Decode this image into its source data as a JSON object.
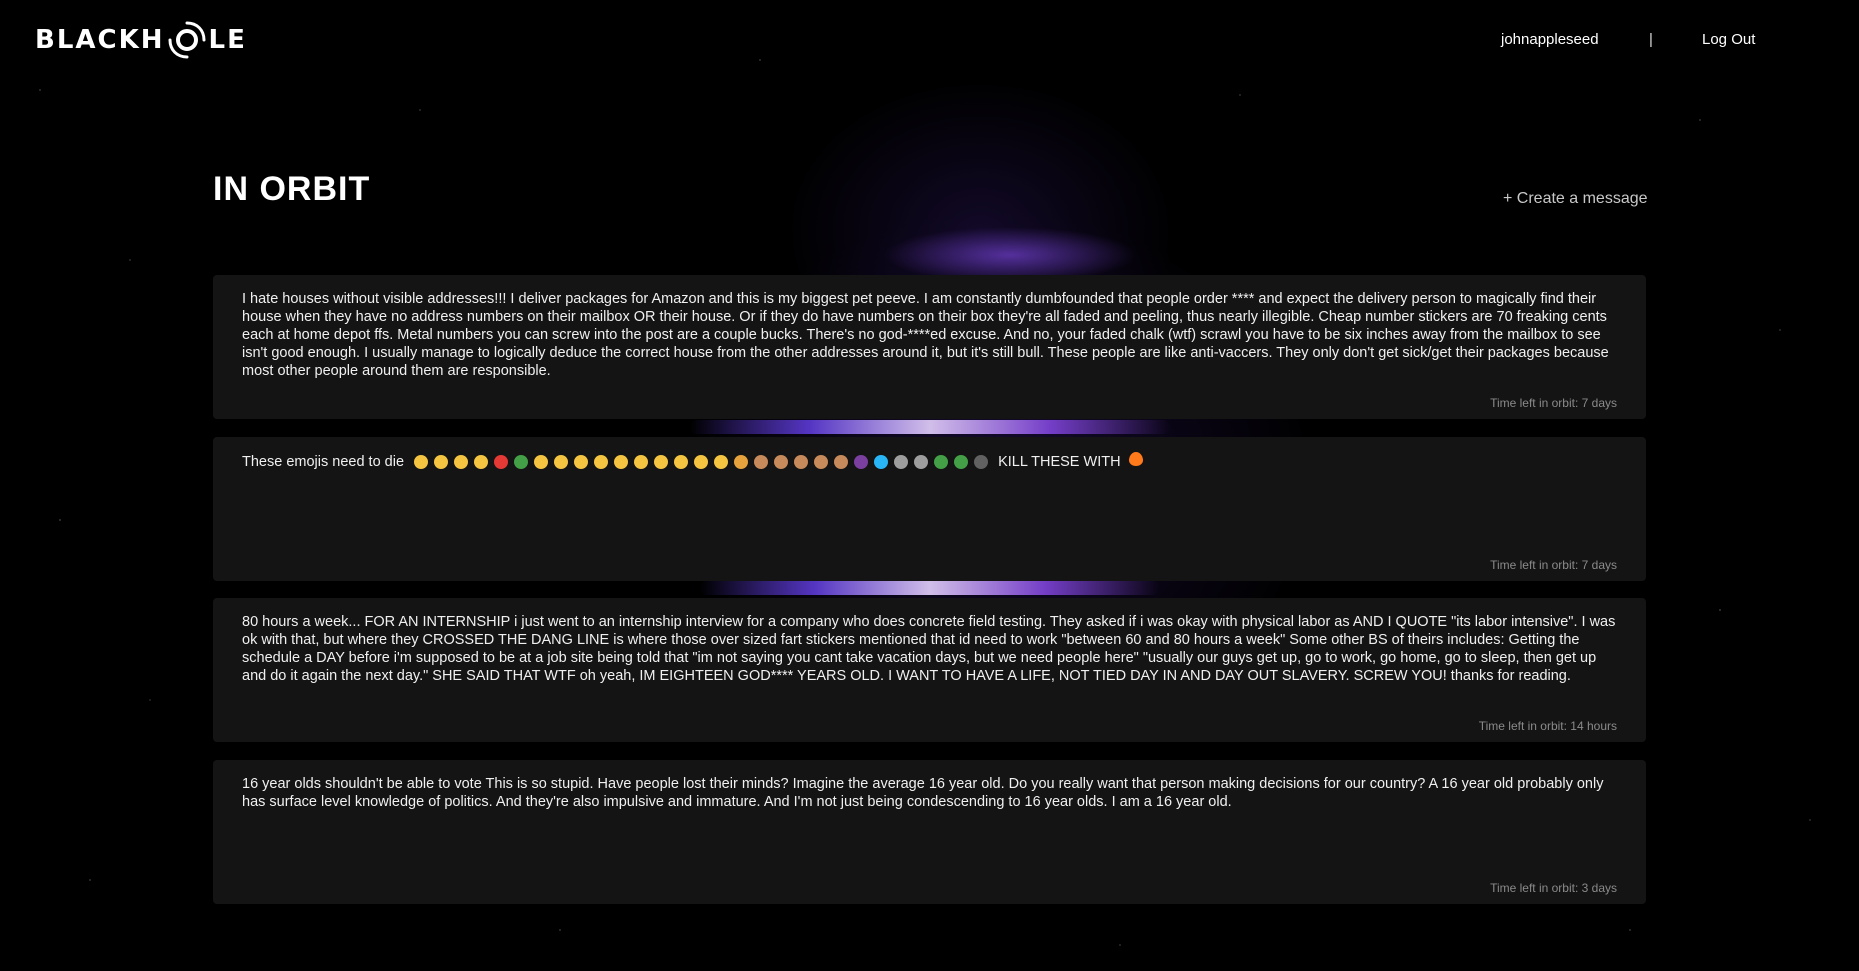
{
  "app": {
    "logo_text_left": "BLACKH",
    "logo_text_right": "LE",
    "username": "johnappleseed",
    "divider": "|",
    "logout_label": "Log Out"
  },
  "page": {
    "title": "IN ORBIT",
    "create_label": "+ Create a message"
  },
  "posts": [
    {
      "text": "I hate houses without visible addresses!!! I deliver packages for Amazon and this is my biggest pet peeve. I am constantly dumbfounded that people order **** and expect the delivery person to magically find their house when they have no address numbers on their mailbox OR their house. Or if they do have numbers on their box they're all faded and peeling, thus nearly illegible. Cheap number stickers are 70 freaking cents each at home depot ffs. Metal numbers you can screw into the post are a couple bucks. There's no god-****ed excuse. And no, your faded chalk (wtf) scrawl you have to be six inches away from the mailbox to see isn't good enough. I usually manage to logically deduce the correct house from the other addresses around it, but it's still bull. These people are like anti-vaccers. They only don't get sick/get their packages because most other people around them are responsible.",
      "time_left": "Time left in orbit: 7 days"
    },
    {
      "text_before": "These emojis need to die",
      "text_after": "KILL THESE WITH",
      "time_left": "Time left in orbit: 7 days"
    },
    {
      "text": "80 hours a week... FOR AN INTERNSHIP i just went to an internship interview for a company who does concrete field testing. They asked if i was okay with physical labor as AND I QUOTE \"its labor intensive\". I was ok with that, but where they CROSSED THE DANG LINE is where those over sized fart stickers mentioned that id need to work \"between 60 and 80 hours a week\" Some other BS of theirs includes: Getting the schedule a DAY before i'm supposed to be at a job site being told that \"im not saying you cant take vacation days, but we need people here\" \"usually our guys get up, go to work, go home, go to sleep, then get up and do it again the next day.\" SHE SAID THAT WTF oh yeah, IM EIGHTEEN GOD**** YEARS OLD. I WANT TO HAVE A LIFE, NOT TIED DAY IN AND DAY OUT SLAVERY. SCREW YOU! thanks for reading.",
      "time_left": "Time left in orbit: 14 hours"
    },
    {
      "text": "16 year olds shouldn't be able to vote This is so stupid. Have people lost their minds? Imagine the average 16 year old. Do you really want that person making decisions for our country? A 16 year old probably only has surface level knowledge of politics. And they're also impulsive and immature. And I'm not just being condescending to 16 year olds. I am a 16 year old.",
      "time_left": "Time left in orbit: 3 days"
    }
  ],
  "emoji_colors": [
    "#f5c542",
    "#f5c542",
    "#f5c542",
    "#f5c542",
    "#e53935",
    "#43a047",
    "#f5c542",
    "#f5c542",
    "#f5c542",
    "#f5c542",
    "#f5c542",
    "#f5c542",
    "#f5c542",
    "#f5c542",
    "#f5c542",
    "#f5c542",
    "#e6a23c",
    "#c78a5a",
    "#c78a5a",
    "#c78a5a",
    "#c78a5a",
    "#c78a5a",
    "#7b3fa0",
    "#29b6f6",
    "#9e9e9e",
    "#9e9e9e",
    "#43a047",
    "#43a047",
    "#616161"
  ],
  "fire_color": "#ff7a1a"
}
